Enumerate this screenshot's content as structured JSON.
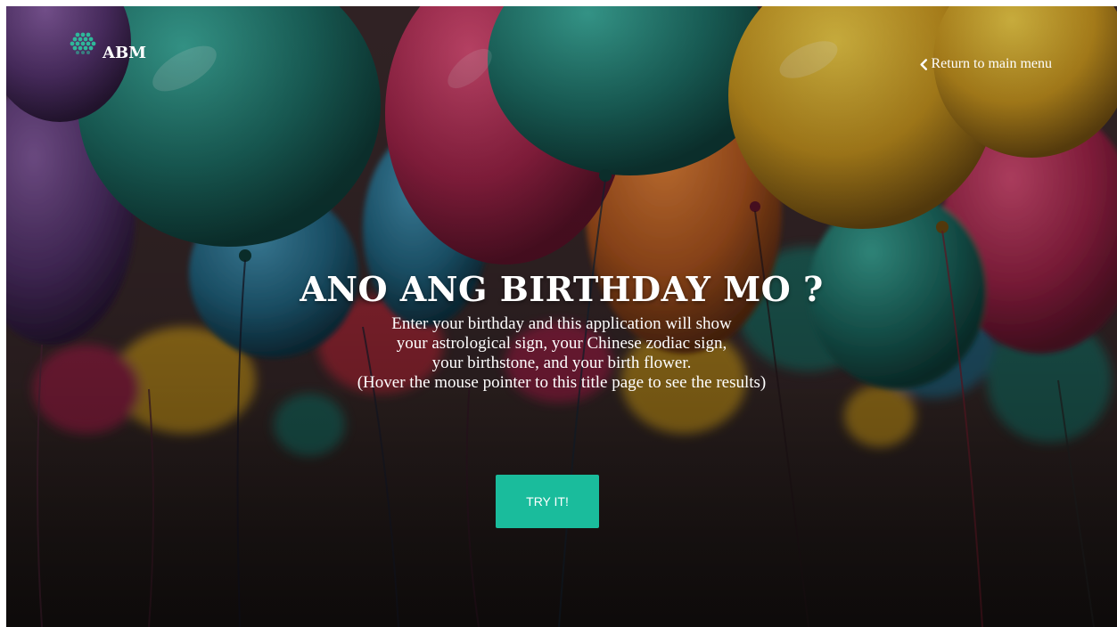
{
  "brand": {
    "logo_text": "ABM",
    "logo_icon": "hexagon-dots-icon"
  },
  "nav": {
    "back_label": "Return to main menu",
    "back_icon": "chevron-left-icon"
  },
  "hero": {
    "title": "ANO ANG BIRTHDAY MO ?",
    "description_lines": [
      "Enter your birthday and this application will show",
      "your astrological sign, your Chinese zodiac sign,",
      "your birthstone, and your birth flower.",
      "(Hover the mouse pointer to this title page to see the results)"
    ]
  },
  "cta": {
    "label": "TRY IT!"
  },
  "colors": {
    "accent": "#1abc9c",
    "logo_teal": "#2fb89a",
    "text": "#ffffff"
  },
  "background": {
    "subject": "colorful balloons photo"
  }
}
